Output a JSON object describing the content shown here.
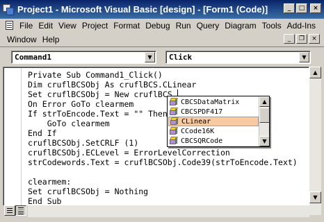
{
  "window": {
    "title": "Project1 - Microsoft Visual Basic [design] - [Form1 (Code)]"
  },
  "title_buttons": {
    "minimize": "_",
    "maximize": "□",
    "close": "×"
  },
  "menu": {
    "row1": [
      "File",
      "Edit",
      "View",
      "Project",
      "Format",
      "Debug",
      "Run",
      "Query",
      "Diagram",
      "Tools",
      "Add-Ins"
    ],
    "row2": [
      "Window",
      "Help"
    ]
  },
  "mdi_buttons": {
    "minimize": "_",
    "restore": "❐",
    "close": "×"
  },
  "object_combo": {
    "value": "Command1"
  },
  "procedure_combo": {
    "value": "Click"
  },
  "code_lines": [
    "Private Sub Command1_Click()",
    "Dim cruflBCSObj As cruflBCS.CLinear",
    "Set cruflBCSObj = New cruflBCS.",
    "On Error GoTo clearmem",
    "If strToEncode.Text = \"\" Then",
    "    GoTo clearmem",
    "End If",
    "cruflBCSObj.SetCRLF (1)",
    "cruflBCSObj.ECLevel = ErrorLevelCorrection",
    "strCodewords.Text = cruflBCSObj.Code39(strToEncode.Text)",
    "",
    "clearmem:",
    "Set cruflBCSObj = Nothing",
    "End Sub"
  ],
  "autocomplete": {
    "items": [
      "CBCSDataMatrix",
      "CBCSPDF417",
      "CLinear",
      "CCode16K",
      "CBCSQRCode"
    ],
    "selected_index": 2
  },
  "icons": {
    "app": "vb-project-icon",
    "doc": "code-window-icon",
    "item": "class-cube-icon"
  }
}
